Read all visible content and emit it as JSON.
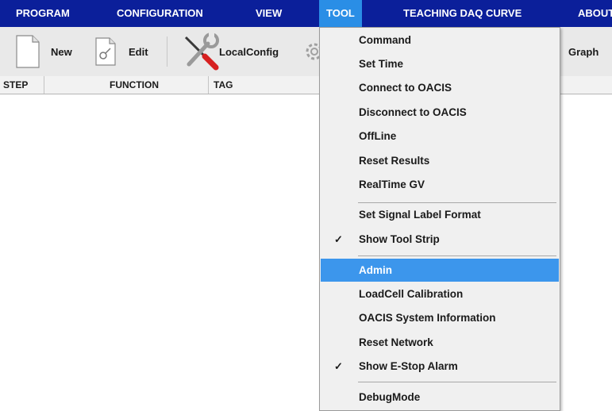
{
  "menubar": {
    "items": [
      {
        "label": "PROGRAM"
      },
      {
        "label": "CONFIGURATION"
      },
      {
        "label": "VIEW"
      },
      {
        "label": "TOOL"
      },
      {
        "label": "TEACHING DAQ CURVE"
      },
      {
        "label": "ABOUT"
      }
    ],
    "active": "TOOL"
  },
  "toolbar": {
    "new_label": "New",
    "edit_label": "Edit",
    "localconfig_label": "LocalConfig",
    "graph_label": "Graph"
  },
  "grid": {
    "columns": [
      "STEP",
      "FUNCTION",
      "TAG"
    ]
  },
  "tool_menu": {
    "items": [
      {
        "label": "Command",
        "checked": false
      },
      {
        "label": "Set Time",
        "checked": false
      },
      {
        "label": "Connect to OACIS",
        "checked": false
      },
      {
        "label": "Disconnect to OACIS",
        "checked": false
      },
      {
        "label": "OffLine",
        "checked": false
      },
      {
        "label": "Reset Results",
        "checked": false
      },
      {
        "label": "RealTime GV",
        "checked": false
      },
      {
        "label": "Set Signal Label Format",
        "checked": false
      },
      {
        "label": "Show Tool Strip",
        "checked": true
      },
      {
        "label": "Admin",
        "checked": false,
        "highlighted": true
      },
      {
        "label": "LoadCell Calibration",
        "checked": false
      },
      {
        "label": "OACIS System Information",
        "checked": false
      },
      {
        "label": "Reset Network",
        "checked": false
      },
      {
        "label": "Show E-Stop Alarm",
        "checked": true
      },
      {
        "label": "DebugMode",
        "checked": false
      }
    ],
    "check_glyph": "✓"
  },
  "colors": {
    "menubar_bg": "#0b1f9a",
    "active_menu_bg": "#2a8ee6",
    "highlight_bg": "#3c96ec"
  }
}
